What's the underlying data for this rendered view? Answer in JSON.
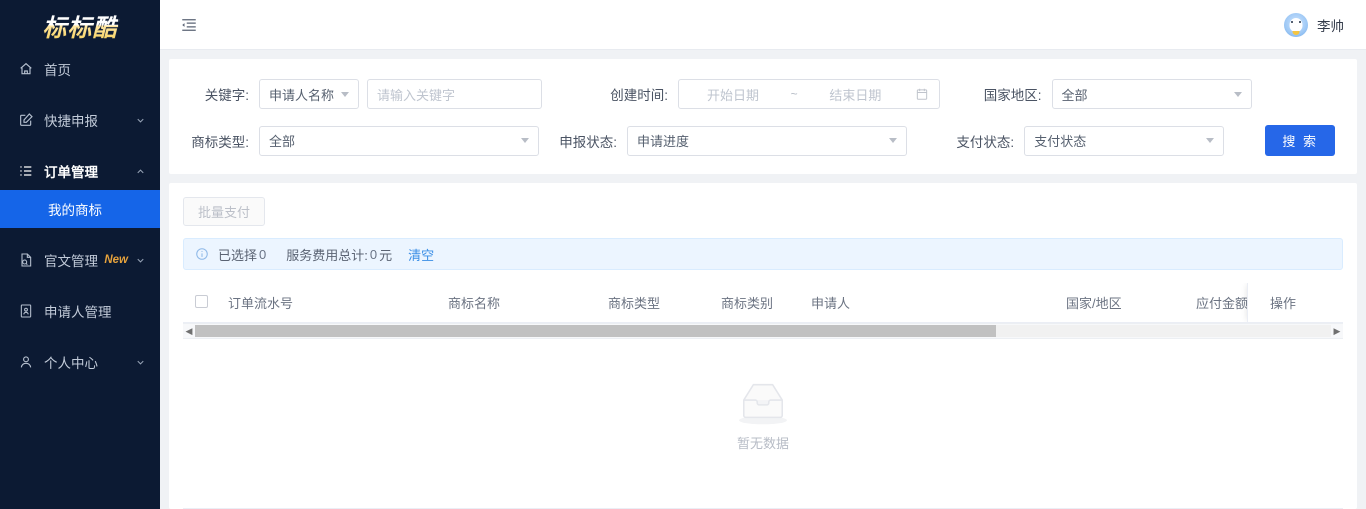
{
  "sidebar": {
    "logo": "标标酷",
    "items": [
      {
        "label": "首页",
        "icon": "home-icon",
        "expandable": false
      },
      {
        "label": "快捷申报",
        "icon": "edit-square-icon",
        "expandable": true
      },
      {
        "label": "订单管理",
        "icon": "list-icon",
        "expandable": true,
        "expanded": true
      },
      {
        "label": "官文管理",
        "icon": "document-check-icon",
        "expandable": true,
        "badge": "New"
      },
      {
        "label": "申请人管理",
        "icon": "applicant-document-icon",
        "expandable": false
      },
      {
        "label": "个人中心",
        "icon": "user-icon",
        "expandable": true
      }
    ],
    "submenu": {
      "label": "我的商标",
      "active": true
    },
    "active_color": "#1565e8",
    "background_color": "#0c1a33"
  },
  "topbar": {
    "fold_icon": "menu-fold-icon",
    "username": "李帅",
    "avatar": "user-avatar"
  },
  "search_form": {
    "keyword": {
      "label": "关键字:",
      "select_value": "申请人名称",
      "input_placeholder": "请输入关键字",
      "input_value": ""
    },
    "create_time": {
      "label": "创建时间:",
      "start_placeholder": "开始日期",
      "separator": "~",
      "end_placeholder": "结束日期",
      "icon": "calendar-icon"
    },
    "country": {
      "label": "国家地区:",
      "value": "全部"
    },
    "trademark_type": {
      "label": "商标类型:",
      "value": "全部"
    },
    "declare_status": {
      "label": "申报状态:",
      "value": "申请进度"
    },
    "pay_status": {
      "label": "支付状态:",
      "value": "支付状态"
    },
    "search_button": "搜 索",
    "button_color": "#2667e8"
  },
  "toolbar": {
    "bulk_pay_label": "批量支付",
    "bulk_pay_disabled": true
  },
  "alert": {
    "icon": "info-circle-icon",
    "selected_label": "已选择",
    "selected_count": "0",
    "fee_label": "服务费用总计:",
    "fee_value": "0",
    "fee_unit": "元",
    "clear_label": "清空",
    "background_color": "#ecf5ff"
  },
  "table": {
    "headers": [
      "订单流水号",
      "商标名称",
      "商标类型",
      "商标类别",
      "申请人",
      "国家/地区",
      "应付金额"
    ],
    "fixed_header": "操作",
    "select_all_checkbox": "unchecked",
    "rows": [],
    "empty_text": "暂无数据",
    "empty_icon": "empty-inbox-icon",
    "scrollbar": {
      "orientation": "horizontal",
      "left_arrow": "◀",
      "right_arrow": "▶",
      "thumb_percent": "70"
    }
  }
}
